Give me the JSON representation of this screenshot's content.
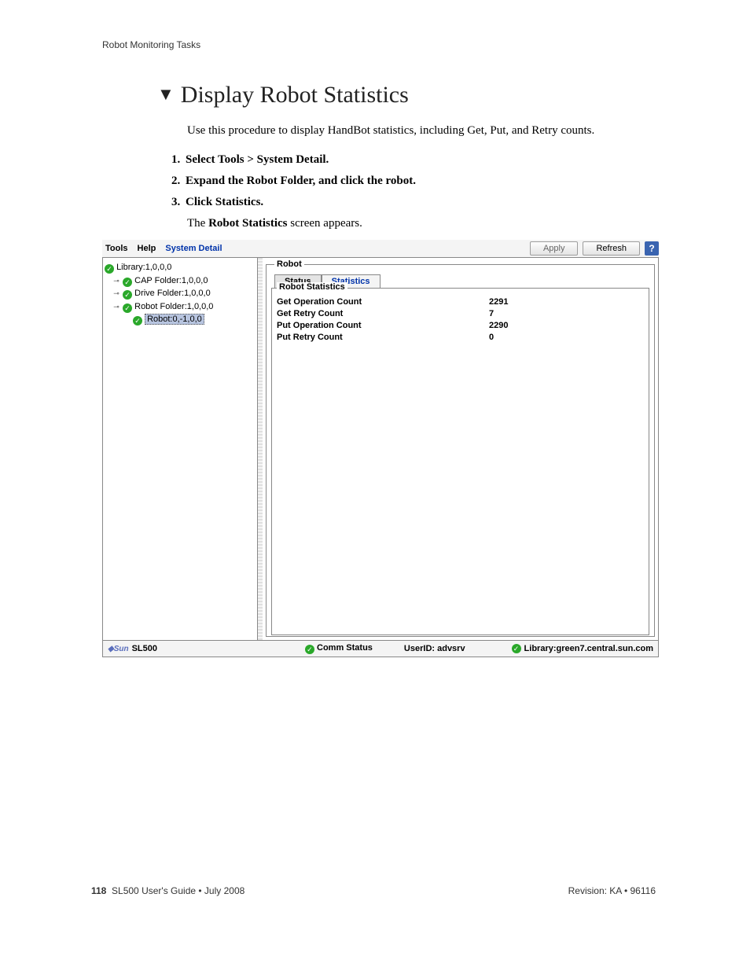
{
  "header": {
    "running": "Robot Monitoring Tasks"
  },
  "section": {
    "title": "Display Robot Statistics",
    "intro": "Use this procedure to display HandBot statistics, including Get, Put, and Retry counts."
  },
  "steps": [
    "Select Tools > System Detail.",
    "Expand the Robot Folder, and click the robot.",
    "Click Statistics."
  ],
  "result_line_prefix": "The ",
  "result_line_bold": "Robot Statistics",
  "result_line_suffix": " screen appears.",
  "ui": {
    "menu": {
      "tools": "Tools",
      "help": "Help",
      "sysdetail": "System Detail"
    },
    "buttons": {
      "apply": "Apply",
      "refresh": "Refresh",
      "help": "?"
    },
    "tree": {
      "library": "Library:1,0,0,0",
      "cap": "CAP Folder:1,0,0,0",
      "drive": "Drive Folder:1,0,0,0",
      "robotFolder": "Robot Folder:1,0,0,0",
      "robot": "Robot:0,-1,0,0"
    },
    "group": {
      "robot": "Robot",
      "stats": "Robot Statistics"
    },
    "tabs": {
      "status": "Status",
      "statistics": "Statistics"
    },
    "stats": {
      "getOp": {
        "label": "Get Operation Count",
        "value": "2291"
      },
      "getRetry": {
        "label": "Get Retry Count",
        "value": "7"
      },
      "putOp": {
        "label": "Put Operation Count",
        "value": "2290"
      },
      "putRetry": {
        "label": "Put Retry Count",
        "value": "0"
      }
    },
    "status": {
      "product": "SL500",
      "comm": "Comm Status",
      "user": "UserID: advsrv",
      "library": "Library:green7.central.sun.com"
    }
  },
  "footer": {
    "page": "118",
    "book": "SL500 User's Guide  •  July 2008",
    "rev": "Revision: KA  •  96116"
  }
}
